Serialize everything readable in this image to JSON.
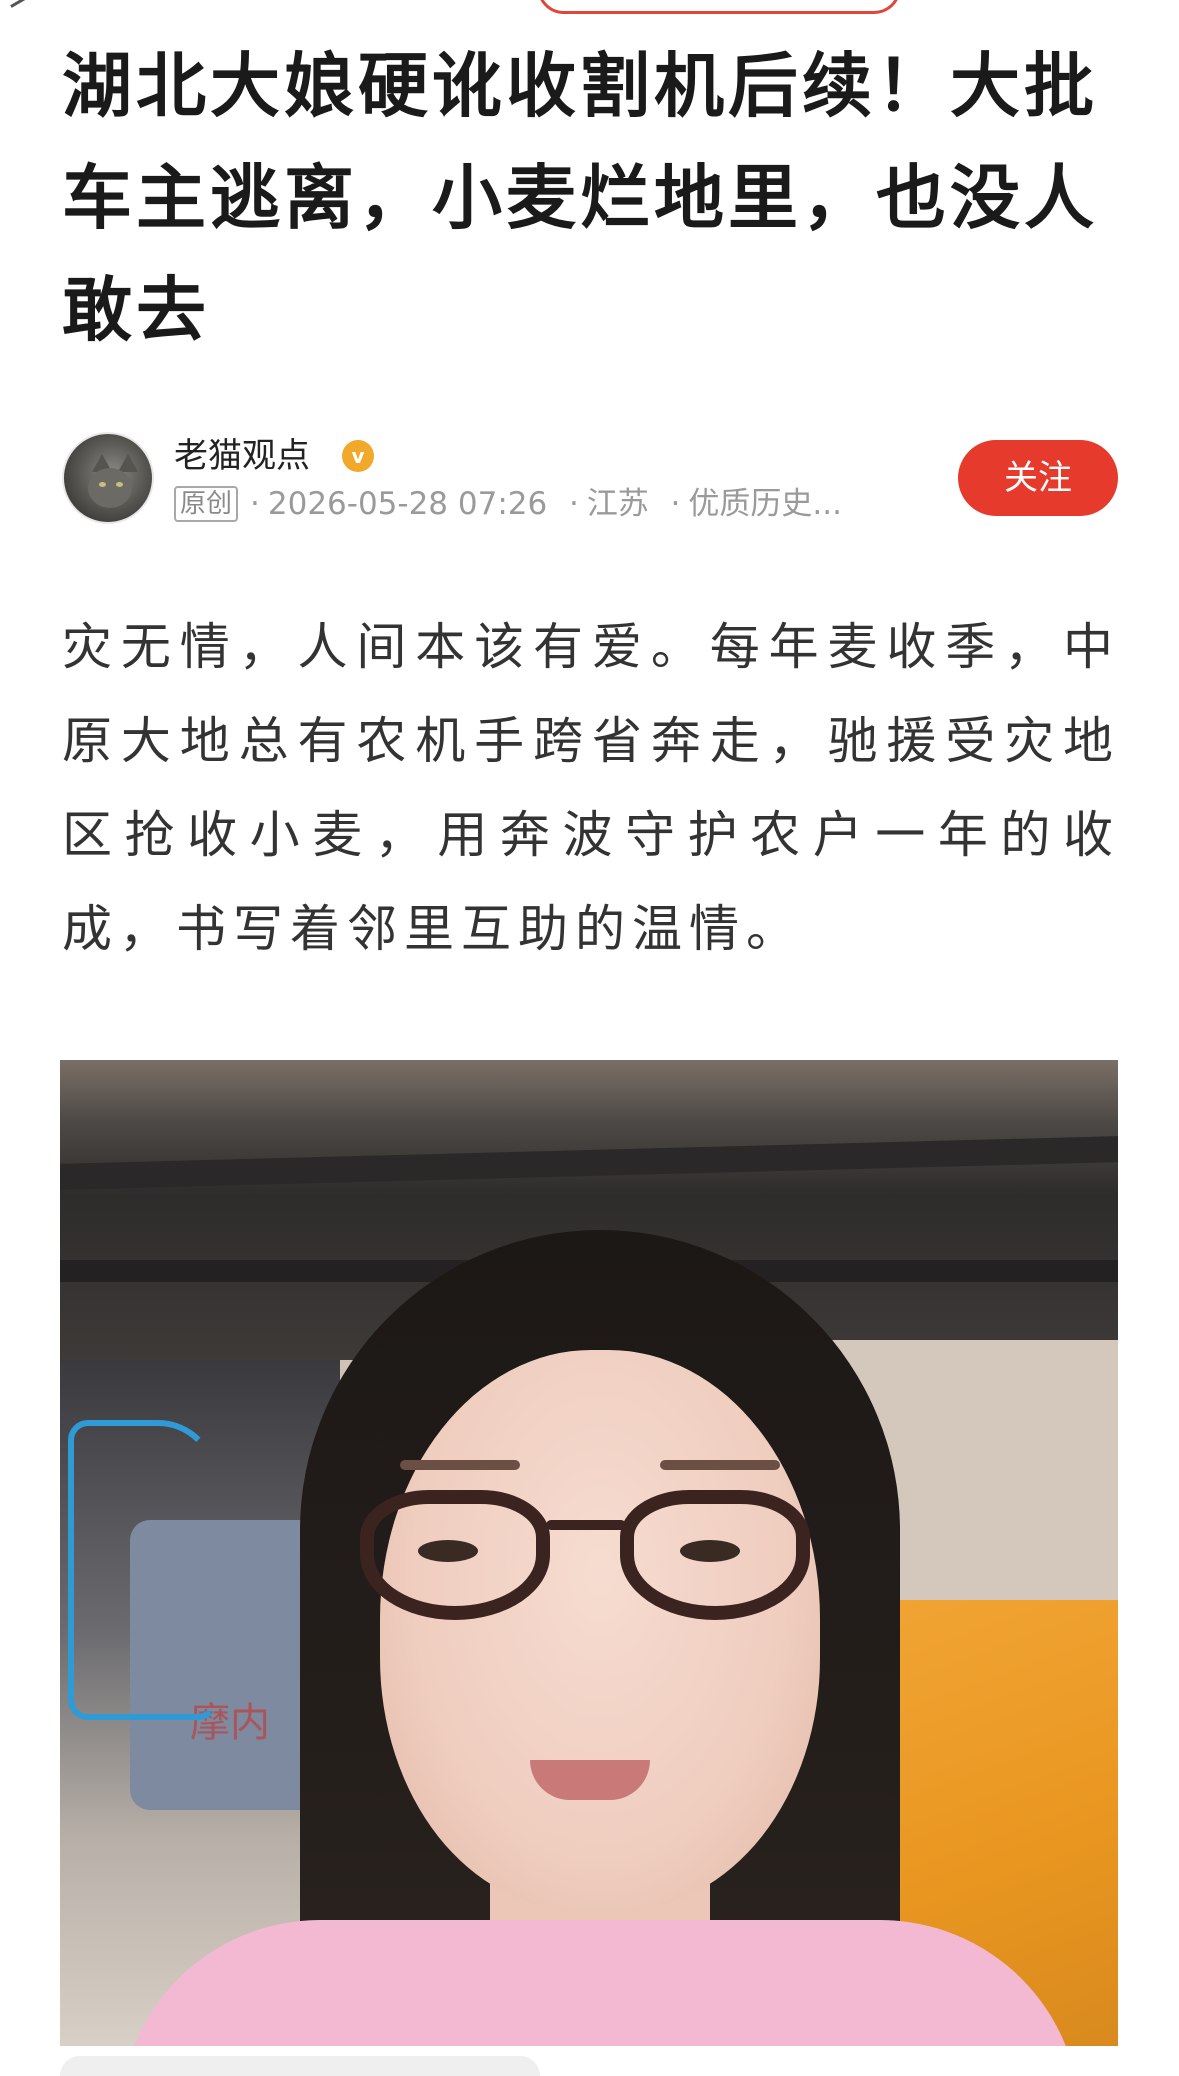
{
  "article": {
    "title": "湖北大娘硬讹收割机后续！大批车主逃离，小麦烂地里，也没人敢去",
    "author": {
      "name": "老猫观点",
      "verified_icon": "v-verified-icon",
      "original_label": "原创",
      "datetime": "2026-05-28 07:26",
      "location": "江苏",
      "tag": "优质历史..."
    },
    "follow_label": "关注",
    "body_paragraph": "灾无情，人间本该有爱。每年麦收季，中原大地总有农机手跨省奔走，驰援受灾地区抢收小麦，用奔波守护农户一年的收成，书写着邻里互助的温情。",
    "image_overlay_text": "摩内"
  },
  "colors": {
    "accent": "#e53a2c",
    "verified": "#f0a92a",
    "meta_text": "#9a9a9a"
  }
}
